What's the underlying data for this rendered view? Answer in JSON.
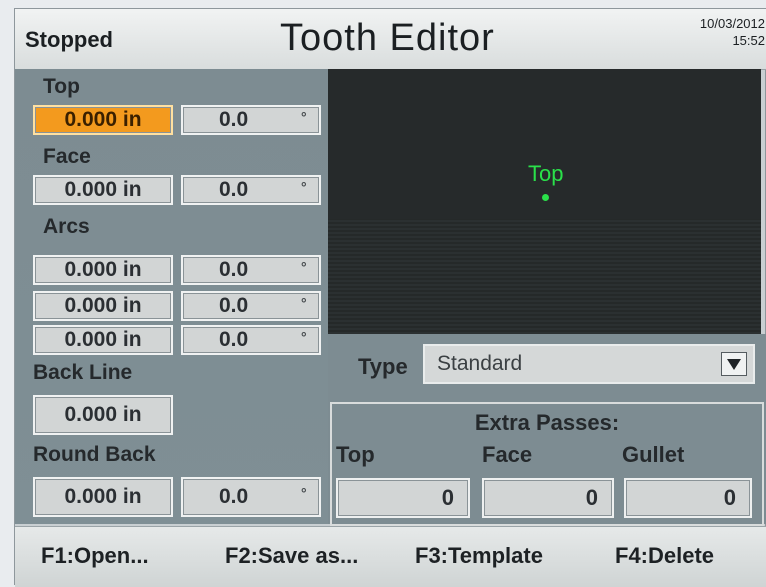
{
  "header": {
    "status": "Stopped",
    "title": "Tooth Editor",
    "date": "10/03/2012",
    "time": "15:52"
  },
  "left": {
    "top_label": "Top",
    "top_length": "0.000 in",
    "top_angle": "0.0",
    "face_label": "Face",
    "face_length": "0.000 in",
    "face_angle": "0.0",
    "arcs_label": "Arcs",
    "arcs": [
      {
        "length": "0.000 in",
        "angle": "0.0"
      },
      {
        "length": "0.000 in",
        "angle": "0.0"
      },
      {
        "length": "0.000 in",
        "angle": "0.0"
      }
    ],
    "back_line_label": "Back Line",
    "back_line_length": "0.000 in",
    "round_back_label": "Round Back",
    "round_back_length": "0.000 in",
    "round_back_angle": "0.0",
    "degree_symbol": "°"
  },
  "preview": {
    "marker_label": "Top"
  },
  "type": {
    "label": "Type",
    "value": "Standard",
    "dropdown_icon": "triangle-down-icon"
  },
  "extra_passes": {
    "title": "Extra Passes:",
    "top_label": "Top",
    "face_label": "Face",
    "gullet_label": "Gullet",
    "top_value": "0",
    "face_value": "0",
    "gullet_value": "0"
  },
  "function_keys": {
    "f1": "F1:Open...",
    "f2": "F2:Save as...",
    "f3": "F3:Template",
    "f4": "F4:Delete"
  },
  "colors": {
    "selected_field": "#f39a1e",
    "preview_marker": "#2ae04a",
    "panel": "#7d8c92"
  }
}
